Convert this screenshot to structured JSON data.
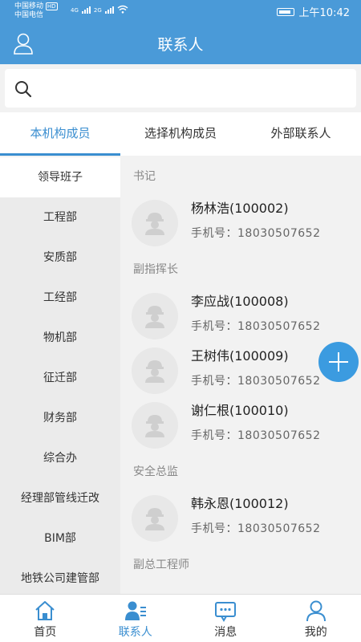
{
  "status": {
    "carrier1": "中国移动",
    "hd": "HD",
    "carrier2": "中国电信",
    "net1": "4G",
    "net2": "2G",
    "time": "上午10:42"
  },
  "nav": {
    "title": "联系人"
  },
  "search": {
    "placeholder": ""
  },
  "tabs": [
    {
      "label": "本机构成员"
    },
    {
      "label": "选择机构成员"
    },
    {
      "label": "外部联系人"
    }
  ],
  "departments": [
    {
      "label": "领导班子"
    },
    {
      "label": "工程部"
    },
    {
      "label": "安质部"
    },
    {
      "label": "工经部"
    },
    {
      "label": "物机部"
    },
    {
      "label": "征迁部"
    },
    {
      "label": "财务部"
    },
    {
      "label": "综合办"
    },
    {
      "label": "经理部管线迁改"
    },
    {
      "label": "BIM部"
    },
    {
      "label": "地铁公司建管部"
    }
  ],
  "groups": [
    {
      "title": "书记",
      "contacts": [
        {
          "name": "杨林浩(100002)",
          "phone": "手机号：18030507652"
        }
      ]
    },
    {
      "title": "副指挥长",
      "contacts": [
        {
          "name": "李应战(100008)",
          "phone": "手机号：18030507652"
        },
        {
          "name": "王树伟(100009)",
          "phone": "手机号：18030507652"
        },
        {
          "name": "谢仁根(100010)",
          "phone": "手机号：18030507652"
        }
      ]
    },
    {
      "title": "安全总监",
      "contacts": [
        {
          "name": "韩永恩(100012)",
          "phone": "手机号：18030507652"
        }
      ]
    },
    {
      "title": "副总工程师",
      "contacts": []
    }
  ],
  "bottom": [
    {
      "label": "首页"
    },
    {
      "label": "联系人"
    },
    {
      "label": "消息"
    },
    {
      "label": "我的"
    }
  ],
  "colors": {
    "primary": "#4a9ad8",
    "accent": "#3a8ed0",
    "fab": "#3b9be0"
  }
}
